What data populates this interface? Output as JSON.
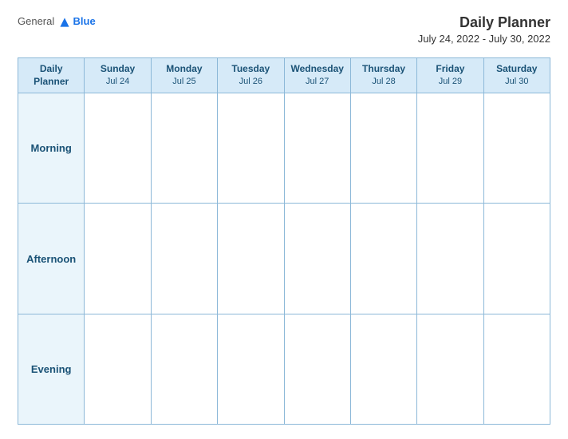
{
  "header": {
    "logo_general": "General",
    "logo_blue": "Blue",
    "main_title": "Daily Planner",
    "date_range": "July 24, 2022 - July 30, 2022"
  },
  "table": {
    "header_label": "Daily\nPlanner",
    "days": [
      {
        "name": "Sunday",
        "date": "Jul 24"
      },
      {
        "name": "Monday",
        "date": "Jul 25"
      },
      {
        "name": "Tuesday",
        "date": "Jul 26"
      },
      {
        "name": "Wednesday",
        "date": "Jul 27"
      },
      {
        "name": "Thursday",
        "date": "Jul 28"
      },
      {
        "name": "Friday",
        "date": "Jul 29"
      },
      {
        "name": "Saturday",
        "date": "Jul 30"
      }
    ],
    "rows": [
      {
        "label": "Morning"
      },
      {
        "label": "Afternoon"
      },
      {
        "label": "Evening"
      }
    ]
  }
}
